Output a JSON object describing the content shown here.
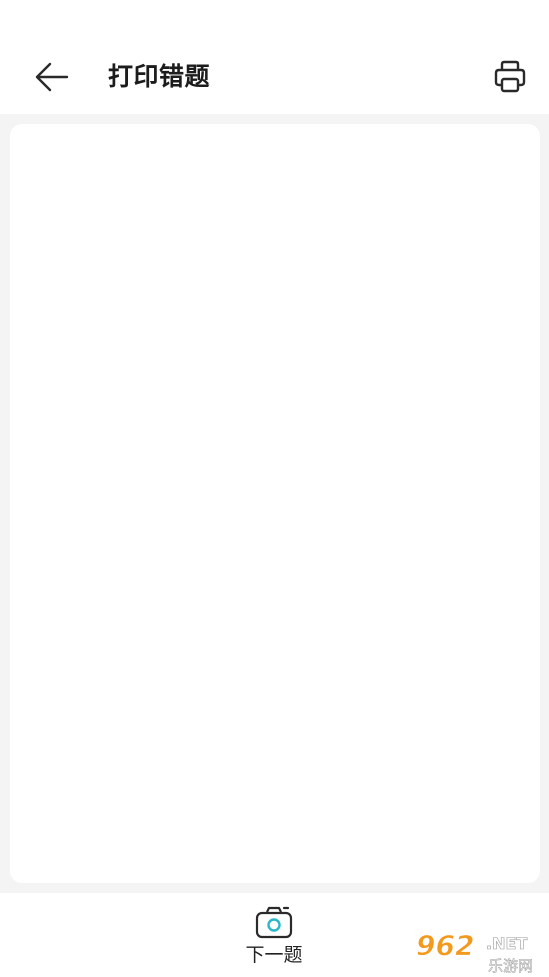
{
  "header": {
    "title": "打印错题"
  },
  "bottom_bar": {
    "next_label": "下一题"
  },
  "watermark": {
    "digits": "962",
    "suffix": ".NET",
    "tagline": "乐游网"
  },
  "icons": {
    "back": "arrow-left-icon",
    "print": "printer-icon",
    "next": "camera-icon"
  },
  "colors": {
    "background": "#f4f4f4",
    "surface": "#ffffff",
    "title_text": "#1c1c1c",
    "icon_stroke": "#2a2a2a",
    "camera_lens": "#2bb7c9",
    "watermark_orange": "#f39a1e"
  }
}
